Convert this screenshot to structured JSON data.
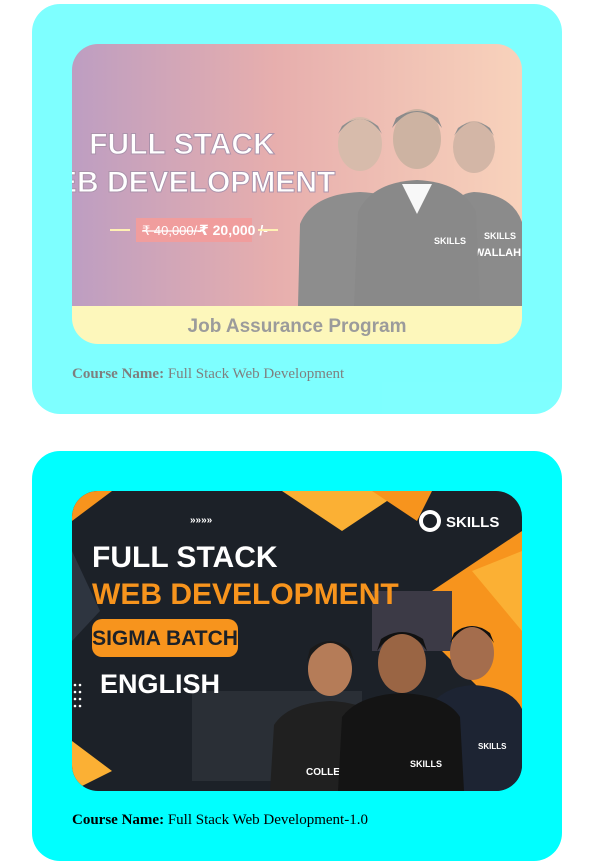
{
  "courses": [
    {
      "caption_label": "Course Name:",
      "course_name": "Full Stack Web Development",
      "thumbnail": {
        "title_line1": "FULL STACK",
        "title_line2": "WEB DEVELOPMENT",
        "old_price": "₹ 40,000/-",
        "new_price": "₹ 20,000 /-",
        "footer_text": "Job Assurance Program",
        "badge": "SKILLS",
        "shirt_text": "WALLAH"
      }
    },
    {
      "caption_label": "Course Name:",
      "course_name": "Full Stack Web Development-1.0",
      "thumbnail": {
        "title_line1": "FULL STACK",
        "title_line2": "WEB DEVELOPMENT",
        "batch_label": "SIGMA BATCH",
        "language": "ENGLISH",
        "brand": "SKILLS",
        "arrows": "»»»»",
        "shirt_text_1": "SKILLS",
        "shirt_text_2": "COLLEG",
        "shirt_text_3": "SKILLS"
      }
    }
  ],
  "colors": {
    "card_bg": "#00ffff",
    "orange": "#f7941d",
    "yellow_footer": "#fdf07a"
  }
}
